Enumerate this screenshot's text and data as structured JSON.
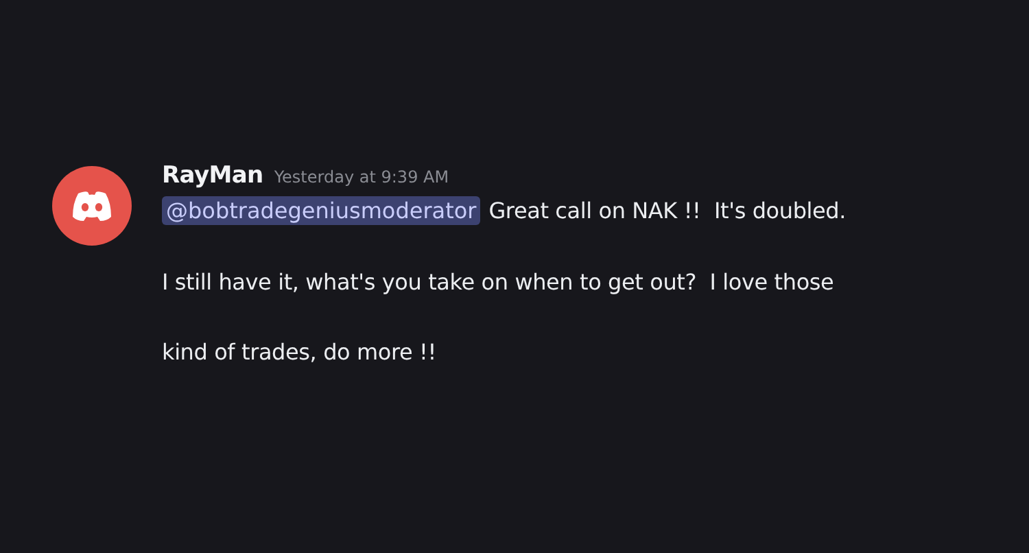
{
  "message": {
    "author": "RayMan",
    "timestamp": "Yesterday at 9:39 AM",
    "mention": "@bobtradegeniusmoderator",
    "first_line": "Great call on NAK !!  It's doubled.",
    "lines": [
      "I still have it, what's you take on when to get out?  I love those",
      "kind of trades, do more !!"
    ]
  }
}
